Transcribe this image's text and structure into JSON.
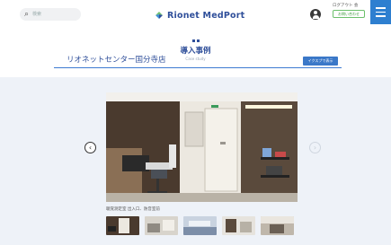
{
  "header": {
    "search_placeholder": "検索",
    "logo_text": "Rionet MedPort",
    "link_1": "ログアウト 会",
    "link_2": "お問い合わせ",
    "brand_color": "#2f4f9a",
    "accent_color": "#3b78c8"
  },
  "page": {
    "title": "導入事例",
    "subtitle": "Case study",
    "facility_name": "リオネットセンター国分寺店",
    "map_button": "イクスプで表示"
  },
  "gallery": {
    "caption": "聴覚測定室 出入口、防音室前",
    "prev_label": "‹",
    "next_label": "›",
    "thumbnail_count": 5,
    "active_index": 0
  }
}
